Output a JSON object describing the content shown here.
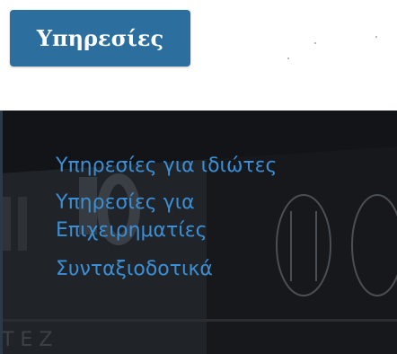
{
  "header": {
    "services_button_label": "Υπηρεσίες"
  },
  "menu": {
    "items": [
      {
        "label": "Υπηρεσίες για ιδιώτες"
      },
      {
        "label": "Υπηρεσίες για Επιχειρηματίες"
      },
      {
        "label": "Συνταξιοδοτικά"
      }
    ]
  },
  "colors": {
    "button_bg": "#2c6e9e",
    "panel_bg": "#1b1e22",
    "link": "#3a8fd6"
  }
}
